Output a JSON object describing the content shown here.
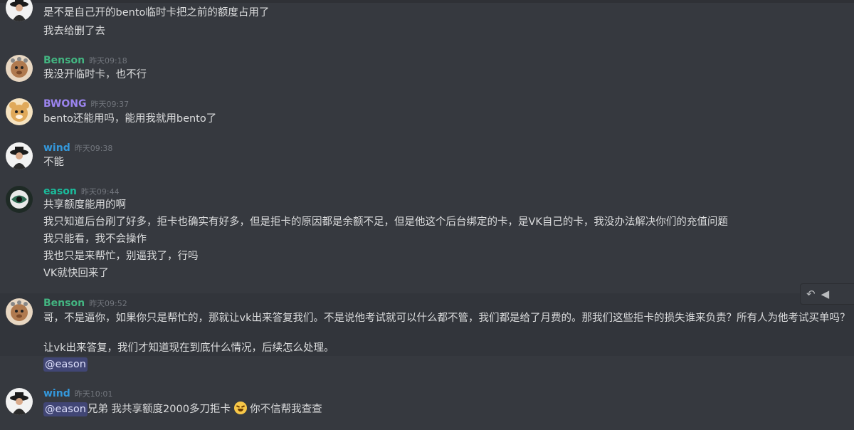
{
  "colors": {
    "background": "#36393f",
    "highlight": "#32353b",
    "benson": "#43b581",
    "bwong": "#9b84ee",
    "wind": "#3498db",
    "eason": "#1abc9c",
    "mention_bg": "#414675"
  },
  "messages": {
    "m0": {
      "line1": "是不是自己开的bento临时卡把之前的额度占用了",
      "line2": "我去给删了去"
    },
    "m1": {
      "user": "Benson",
      "time": "昨天09:18",
      "line1": "我没开临时卡，也不行"
    },
    "m2": {
      "user": "BWONG",
      "time": "昨天09:37",
      "line1": "bento还能用吗，能用我就用bento了"
    },
    "m3": {
      "user": "wind",
      "time": "昨天09:38",
      "line1": "不能"
    },
    "m4": {
      "user": "eason",
      "time": "昨天09:44",
      "line1": "共享额度能用的啊",
      "line2": "我只知道后台刷了好多，拒卡也确实有好多，但是拒卡的原因都是余额不足，但是他这个后台绑定的卡，是VK自己的卡，我没办法解决你们的充值问题",
      "line3": "我只能看，我不会操作",
      "line4": "我也只是来帮忙，别逼我了，行吗",
      "line5": "VK就快回来了"
    },
    "m5": {
      "user": "Benson",
      "time": "昨天09:52",
      "line1": "哥，不是逼你，如果你只是帮忙的，那就让vk出来答复我们。不是说他考试就可以什么都不管，我们都是给了月费的。那我们这些拒卡的损失谁来负责？所有人为他考试买单吗？",
      "line2": "让vk出来答复，我们才知道现在到底什么情况，后续怎么处理。",
      "mention": "@eason"
    },
    "m6": {
      "user": "wind",
      "time": "昨天10:01",
      "mention": "@eason",
      "text_a": "兄弟  我共享额度2000多刀拒卡",
      "text_b": " 你不信帮我查查"
    }
  },
  "toolbar": {
    "reply_icon": "reply-icon",
    "more_icon": "more-icon"
  }
}
